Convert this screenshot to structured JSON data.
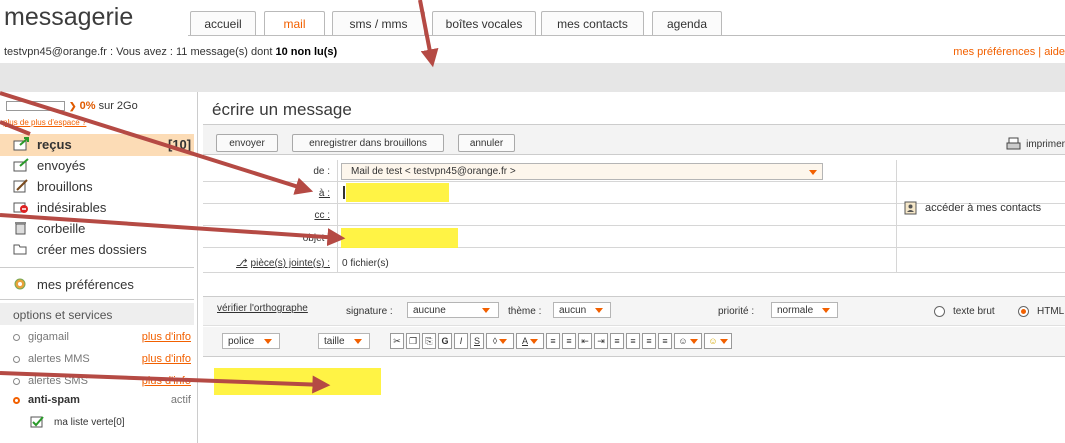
{
  "app": {
    "brand": "messagerie"
  },
  "tabs": [
    {
      "label": "accueil",
      "active": false
    },
    {
      "label": "mail",
      "active": true
    },
    {
      "label": "sms / mms",
      "active": false
    },
    {
      "label": "boîtes vocales",
      "active": false
    },
    {
      "label": "mes contacts",
      "active": false
    },
    {
      "label": "agenda",
      "active": false
    }
  ],
  "status": {
    "email": "testvpn45@orange.fr",
    "prefix": " : Vous avez : 11 message(s) dont ",
    "unread": "10 non lu(s)",
    "links": "mes préférences  |  aide"
  },
  "sidebar": {
    "quota_percent": "0%",
    "quota_text": "sur 2Go",
    "quota_fill": 0,
    "more_space": "plus de plus d'espace ?",
    "folders": [
      {
        "label": "reçus",
        "count": "[10]",
        "icon": "inbox-icon",
        "selected": true
      },
      {
        "label": "envoyés",
        "icon": "sent-icon"
      },
      {
        "label": "brouillons",
        "icon": "drafts-icon"
      },
      {
        "label": "indésirables",
        "icon": "spam-icon"
      },
      {
        "label": "corbeille",
        "icon": "trash-icon"
      },
      {
        "label": "créer mes dossiers",
        "icon": "folder-icon"
      }
    ],
    "preferences": "mes préférences",
    "options_title": "options et services",
    "options": [
      {
        "label": "gigamail",
        "link": "plus d'info"
      },
      {
        "label": "alertes MMS",
        "link": "plus d'info"
      },
      {
        "label": "alertes SMS",
        "link": "plus d'info"
      }
    ],
    "antispam": {
      "label": "anti-spam",
      "state": "actif"
    },
    "green_list": "ma liste verte[0]"
  },
  "compose": {
    "title": "écrire un message",
    "buttons": {
      "send": "envoyer",
      "save_draft": "enregistrer dans brouillons",
      "cancel": "annuler",
      "print": "imprimer"
    },
    "from_label": "de :",
    "from_value": "Mail de test < testvpn45@orange.fr >",
    "to_label": "à :",
    "cc_label": "cc :",
    "subject_label": "objet :",
    "attach_label": "pièce(s) jointe(s) :",
    "attach_value": "0 fichier(s)",
    "contacts_link": "accéder à mes contacts",
    "spellcheck": "vérifier l'orthographe",
    "signature_label": "signature :",
    "signature_value": "aucune",
    "theme_label": "thème :",
    "theme_value": "aucun",
    "priority_label": "priorité :",
    "priority_value": "normale",
    "plain_text": "texte brut",
    "html": "HTML",
    "font_label": "police",
    "size_label": "taille"
  },
  "colors": {
    "accent": "#f26000",
    "highlight": "#fff235",
    "arrow": "#b54a44"
  }
}
